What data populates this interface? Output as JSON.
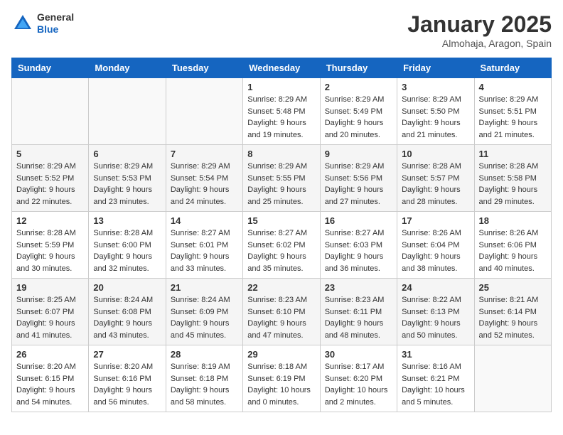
{
  "header": {
    "logo_general": "General",
    "logo_blue": "Blue",
    "month": "January 2025",
    "location": "Almohaja, Aragon, Spain"
  },
  "days_of_week": [
    "Sunday",
    "Monday",
    "Tuesday",
    "Wednesday",
    "Thursday",
    "Friday",
    "Saturday"
  ],
  "weeks": [
    [
      {
        "day": "",
        "info": ""
      },
      {
        "day": "",
        "info": ""
      },
      {
        "day": "",
        "info": ""
      },
      {
        "day": "1",
        "info": "Sunrise: 8:29 AM\nSunset: 5:48 PM\nDaylight: 9 hours\nand 19 minutes."
      },
      {
        "day": "2",
        "info": "Sunrise: 8:29 AM\nSunset: 5:49 PM\nDaylight: 9 hours\nand 20 minutes."
      },
      {
        "day": "3",
        "info": "Sunrise: 8:29 AM\nSunset: 5:50 PM\nDaylight: 9 hours\nand 21 minutes."
      },
      {
        "day": "4",
        "info": "Sunrise: 8:29 AM\nSunset: 5:51 PM\nDaylight: 9 hours\nand 21 minutes."
      }
    ],
    [
      {
        "day": "5",
        "info": "Sunrise: 8:29 AM\nSunset: 5:52 PM\nDaylight: 9 hours\nand 22 minutes."
      },
      {
        "day": "6",
        "info": "Sunrise: 8:29 AM\nSunset: 5:53 PM\nDaylight: 9 hours\nand 23 minutes."
      },
      {
        "day": "7",
        "info": "Sunrise: 8:29 AM\nSunset: 5:54 PM\nDaylight: 9 hours\nand 24 minutes."
      },
      {
        "day": "8",
        "info": "Sunrise: 8:29 AM\nSunset: 5:55 PM\nDaylight: 9 hours\nand 25 minutes."
      },
      {
        "day": "9",
        "info": "Sunrise: 8:29 AM\nSunset: 5:56 PM\nDaylight: 9 hours\nand 27 minutes."
      },
      {
        "day": "10",
        "info": "Sunrise: 8:28 AM\nSunset: 5:57 PM\nDaylight: 9 hours\nand 28 minutes."
      },
      {
        "day": "11",
        "info": "Sunrise: 8:28 AM\nSunset: 5:58 PM\nDaylight: 9 hours\nand 29 minutes."
      }
    ],
    [
      {
        "day": "12",
        "info": "Sunrise: 8:28 AM\nSunset: 5:59 PM\nDaylight: 9 hours\nand 30 minutes."
      },
      {
        "day": "13",
        "info": "Sunrise: 8:28 AM\nSunset: 6:00 PM\nDaylight: 9 hours\nand 32 minutes."
      },
      {
        "day": "14",
        "info": "Sunrise: 8:27 AM\nSunset: 6:01 PM\nDaylight: 9 hours\nand 33 minutes."
      },
      {
        "day": "15",
        "info": "Sunrise: 8:27 AM\nSunset: 6:02 PM\nDaylight: 9 hours\nand 35 minutes."
      },
      {
        "day": "16",
        "info": "Sunrise: 8:27 AM\nSunset: 6:03 PM\nDaylight: 9 hours\nand 36 minutes."
      },
      {
        "day": "17",
        "info": "Sunrise: 8:26 AM\nSunset: 6:04 PM\nDaylight: 9 hours\nand 38 minutes."
      },
      {
        "day": "18",
        "info": "Sunrise: 8:26 AM\nSunset: 6:06 PM\nDaylight: 9 hours\nand 40 minutes."
      }
    ],
    [
      {
        "day": "19",
        "info": "Sunrise: 8:25 AM\nSunset: 6:07 PM\nDaylight: 9 hours\nand 41 minutes."
      },
      {
        "day": "20",
        "info": "Sunrise: 8:24 AM\nSunset: 6:08 PM\nDaylight: 9 hours\nand 43 minutes."
      },
      {
        "day": "21",
        "info": "Sunrise: 8:24 AM\nSunset: 6:09 PM\nDaylight: 9 hours\nand 45 minutes."
      },
      {
        "day": "22",
        "info": "Sunrise: 8:23 AM\nSunset: 6:10 PM\nDaylight: 9 hours\nand 47 minutes."
      },
      {
        "day": "23",
        "info": "Sunrise: 8:23 AM\nSunset: 6:11 PM\nDaylight: 9 hours\nand 48 minutes."
      },
      {
        "day": "24",
        "info": "Sunrise: 8:22 AM\nSunset: 6:13 PM\nDaylight: 9 hours\nand 50 minutes."
      },
      {
        "day": "25",
        "info": "Sunrise: 8:21 AM\nSunset: 6:14 PM\nDaylight: 9 hours\nand 52 minutes."
      }
    ],
    [
      {
        "day": "26",
        "info": "Sunrise: 8:20 AM\nSunset: 6:15 PM\nDaylight: 9 hours\nand 54 minutes."
      },
      {
        "day": "27",
        "info": "Sunrise: 8:20 AM\nSunset: 6:16 PM\nDaylight: 9 hours\nand 56 minutes."
      },
      {
        "day": "28",
        "info": "Sunrise: 8:19 AM\nSunset: 6:18 PM\nDaylight: 9 hours\nand 58 minutes."
      },
      {
        "day": "29",
        "info": "Sunrise: 8:18 AM\nSunset: 6:19 PM\nDaylight: 10 hours\nand 0 minutes."
      },
      {
        "day": "30",
        "info": "Sunrise: 8:17 AM\nSunset: 6:20 PM\nDaylight: 10 hours\nand 2 minutes."
      },
      {
        "day": "31",
        "info": "Sunrise: 8:16 AM\nSunset: 6:21 PM\nDaylight: 10 hours\nand 5 minutes."
      },
      {
        "day": "",
        "info": ""
      }
    ]
  ]
}
